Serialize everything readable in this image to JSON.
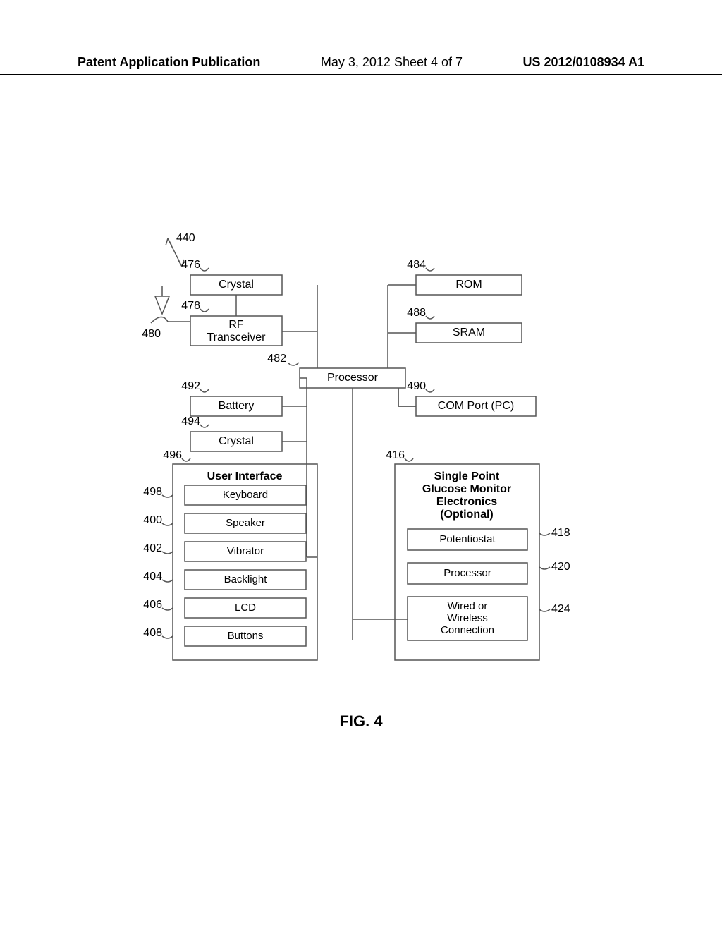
{
  "header": {
    "left": "Patent Application Publication",
    "mid": "May 3, 2012  Sheet 4 of 7",
    "right": "US 2012/0108934 A1"
  },
  "refs": {
    "r440": "440",
    "r476": "476",
    "r478": "478",
    "r480": "480",
    "r482": "482",
    "r484": "484",
    "r488": "488",
    "r490": "490",
    "r492": "492",
    "r494": "494",
    "r496": "496",
    "r498": "498",
    "r400": "400",
    "r402": "402",
    "r404": "404",
    "r406": "406",
    "r408": "408",
    "r416": "416",
    "r418": "418",
    "r420": "420",
    "r424": "424"
  },
  "boxes": {
    "crystal1": "Crystal",
    "rf1": "RF",
    "rf2": "Transceiver",
    "rom": "ROM",
    "sram": "SRAM",
    "processor": "Processor",
    "battery": "Battery",
    "crystal2": "Crystal",
    "comport": "COM Port (PC)",
    "ui_title": "User Interface",
    "keyboard": "Keyboard",
    "speaker": "Speaker",
    "vibrator": "Vibrator",
    "backlight": "Backlight",
    "lcd": "LCD",
    "buttons": "Buttons",
    "spgm1": "Single Point",
    "spgm2": "Glucose Monitor",
    "spgm3": "Electronics",
    "spgm4": "(Optional)",
    "potentiostat": "Potentiostat",
    "proc2": "Processor",
    "wwc1": "Wired or",
    "wwc2": "Wireless",
    "wwc3": "Connection"
  },
  "caption": "FIG. 4"
}
